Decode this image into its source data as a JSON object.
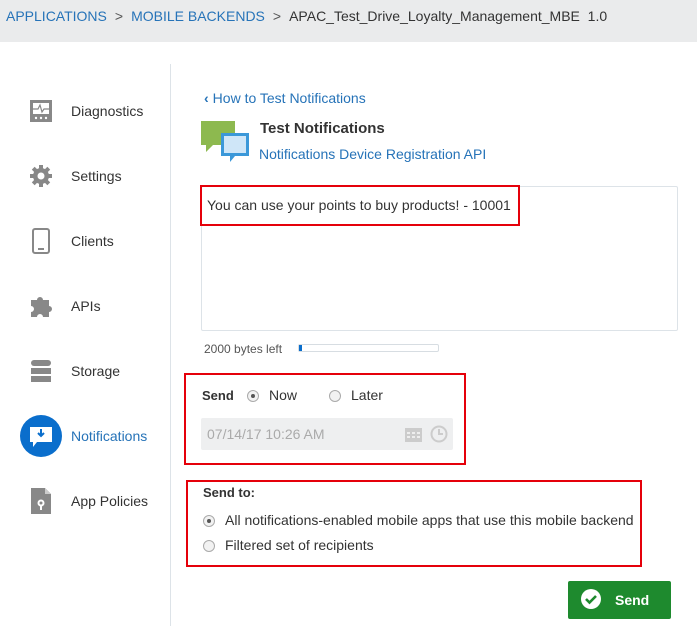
{
  "breadcrumb": {
    "items": [
      "APPLICATIONS",
      "MOBILE BACKENDS"
    ],
    "separator": ">",
    "current": "APAC_Test_Drive_Loyalty_Management_MBE",
    "version": "1.0"
  },
  "sidebar": {
    "items": [
      {
        "label": "Diagnostics",
        "icon": "diagnostics-icon"
      },
      {
        "label": "Settings",
        "icon": "gear-icon"
      },
      {
        "label": "Clients",
        "icon": "phone-icon"
      },
      {
        "label": "APIs",
        "icon": "puzzle-icon"
      },
      {
        "label": "Storage",
        "icon": "database-icon"
      },
      {
        "label": "Notifications",
        "icon": "notification-icon",
        "active": true
      },
      {
        "label": "App Policies",
        "icon": "policy-document-icon"
      }
    ]
  },
  "main": {
    "back_link": "How to Test Notifications",
    "title": "Test Notifications",
    "api_link": "Notifications Device Registration API",
    "message": "You can use your points to buy products! - 10001",
    "bytes_left": "2000 bytes left",
    "bytes_used_fraction": 0.01,
    "send": {
      "label": "Send",
      "options": [
        "Now",
        "Later"
      ],
      "selected": "Now",
      "datetime": "07/14/17 10:26 AM"
    },
    "send_to": {
      "label": "Send to:",
      "options": [
        "All notifications-enabled mobile apps that use this mobile backend",
        "Filtered set of recipients"
      ],
      "selected": 0
    },
    "send_button": "Send"
  },
  "colors": {
    "accent": "#2673b8",
    "highlight": "#e5000a",
    "send_button": "#1e8a2e"
  }
}
